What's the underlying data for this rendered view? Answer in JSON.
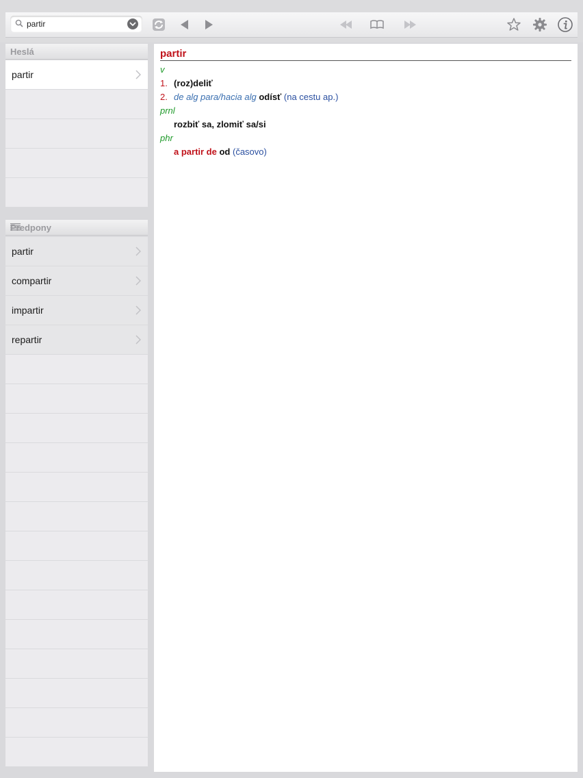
{
  "search": {
    "value": "partir"
  },
  "toolbar": {
    "icons": [
      "search-icon",
      "clear-icon",
      "sync-icon",
      "back-arrow-icon",
      "forward-arrow-icon",
      "rewind-icon",
      "book-icon",
      "fast-forward-icon",
      "star-icon",
      "gear-icon",
      "info-icon"
    ]
  },
  "hesla": {
    "header": "Heslá",
    "items": [
      {
        "label": "partir"
      }
    ]
  },
  "predpony": {
    "header": "Predpony",
    "items": [
      {
        "label": "partir"
      },
      {
        "label": "compartir"
      },
      {
        "label": "impartir"
      },
      {
        "label": "repartir"
      }
    ]
  },
  "entry": {
    "headword": "partir",
    "pos_v": "v",
    "sense1": {
      "num": "1.",
      "text": "(roz)deliť"
    },
    "sense2": {
      "num": "2.",
      "context": "de alg para/hacia alg",
      "text": "odísť",
      "note": "(na cestu ap.)"
    },
    "pos_prnl": "prnl",
    "prnl_text": "rozbiť sa, zlomiť sa/si",
    "pos_phr": "phr",
    "phr": {
      "phrase": "a partir de",
      "translation": "od",
      "note": "(časovo)"
    }
  },
  "colors": {
    "headword": "#c0121a",
    "pos": "#1f9a2a",
    "context": "#3a6fb0",
    "note": "#2a4fa0"
  }
}
